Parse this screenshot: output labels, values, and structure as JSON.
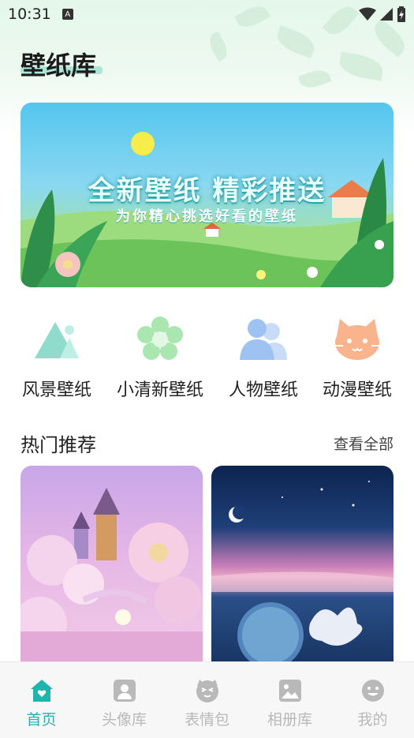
{
  "status_bar": {
    "time": "10:31",
    "notification_icon": "A"
  },
  "page": {
    "title": "壁纸库"
  },
  "banner": {
    "title": "全新壁纸 精彩推送",
    "subtitle": "为你精心挑选好看的壁纸"
  },
  "categories": [
    {
      "label": "风景壁纸",
      "icon": "mountain-icon",
      "color": "#8fdccd"
    },
    {
      "label": "小清新壁纸",
      "icon": "flower-icon",
      "color": "#a9e6b0"
    },
    {
      "label": "人物壁纸",
      "icon": "people-icon",
      "color": "#9ec3f2"
    },
    {
      "label": "动漫壁纸",
      "icon": "cat-icon",
      "color": "#f9b48d"
    }
  ],
  "hot": {
    "title": "热门推荐",
    "view_all": "查看全部"
  },
  "bottom_nav": [
    {
      "label": "首页",
      "icon": "home-icon",
      "active": true
    },
    {
      "label": "头像库",
      "icon": "avatar-icon",
      "active": false
    },
    {
      "label": "表情包",
      "icon": "emoji-cat-icon",
      "active": false
    },
    {
      "label": "相册库",
      "icon": "album-icon",
      "active": false
    },
    {
      "label": "我的",
      "icon": "smile-icon",
      "active": false
    }
  ],
  "colors": {
    "accent": "#1fb5ad",
    "inactive": "#b9b9b9"
  }
}
